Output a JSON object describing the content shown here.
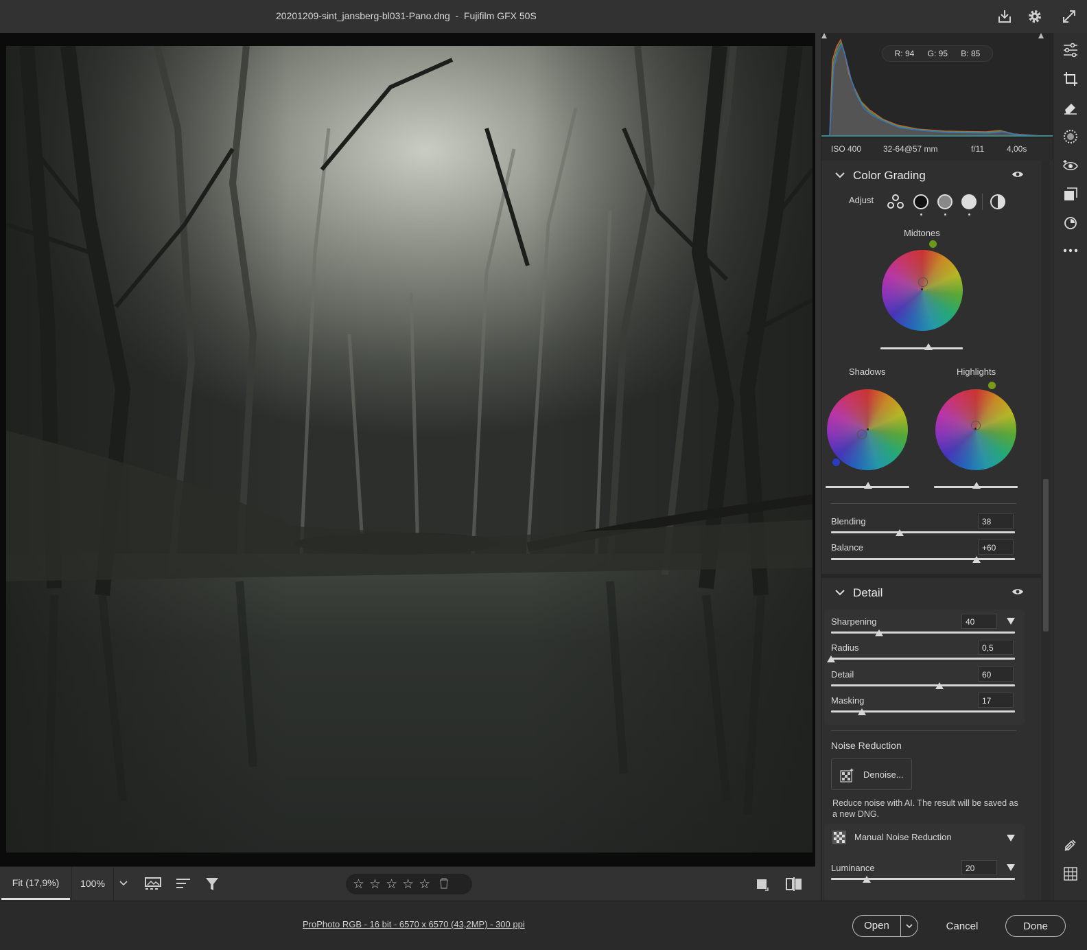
{
  "title": {
    "filename": "20201209-sint_jansberg-bl031-Pano.dng",
    "separator": "-",
    "camera": "Fujifilm GFX 50S"
  },
  "histogram": {
    "r_label": "R:",
    "r": "94",
    "g_label": "G:",
    "g": "95",
    "b_label": "B:",
    "b": "85"
  },
  "exif": {
    "iso": "ISO 400",
    "lens": "32-64@57 mm",
    "aperture": "f/11",
    "shutter": "4,00s"
  },
  "color_grading": {
    "title": "Color Grading",
    "adjust_label": "Adjust",
    "midtones_label": "Midtones",
    "shadows_label": "Shadows",
    "highlights_label": "Highlights",
    "blending_label": "Blending",
    "blending_value": "38",
    "blending_level": 0.38,
    "balance_label": "Balance",
    "balance_value": "+60",
    "balance_level": 0.8
  },
  "detail": {
    "title": "Detail",
    "sharpening_label": "Sharpening",
    "sharpening_value": "40",
    "radius_label": "Radius",
    "radius_value": "0,5",
    "detail_label": "Detail",
    "detail_value": "60",
    "masking_label": "Masking",
    "masking_value": "17",
    "noise_reduction_label": "Noise Reduction",
    "denoise_label": "Denoise...",
    "denoise_note": "Reduce noise with AI. The result will be saved as a new DNG.",
    "manual_nr_label": "Manual Noise Reduction",
    "luminance_label": "Luminance",
    "luminance_value": "20"
  },
  "view_toolbar": {
    "zoom_fit": "Fit (17,9%)",
    "zoom_100": "100%",
    "rating_stars": 5
  },
  "footer": {
    "workflow": "ProPhoto RGB - 16 bit - 6570 x 6570 (43,2MP) - 300 ppi",
    "open": "Open",
    "cancel": "Cancel",
    "done": "Done"
  },
  "icons": {
    "title_bar": [
      "save-icon",
      "settings-gear-icon",
      "fullscreen-icon"
    ],
    "tool_strip": [
      "edit-sliders-icon",
      "crop-icon",
      "heal-eraser-icon",
      "masking-icon",
      "red-eye-icon",
      "presets-icon",
      "snapshots-icon",
      "more-icon",
      "color-sampler-icon",
      "grid-icon"
    ]
  },
  "colors": {
    "accent": "#d7d7d7",
    "panel_bg": "#2f2f2f",
    "app_bg": "#323232"
  }
}
